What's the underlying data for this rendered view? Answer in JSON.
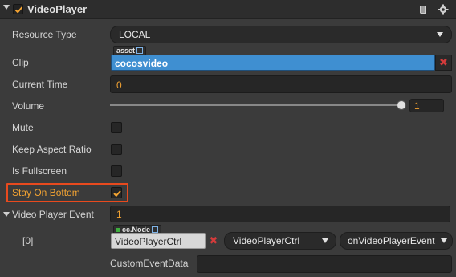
{
  "header": {
    "title": "VideoPlayer",
    "enabled": true,
    "icons": [
      "book-icon",
      "gear-icon"
    ]
  },
  "properties": {
    "resource_type": {
      "label": "Resource Type",
      "value": "LOCAL"
    },
    "clip": {
      "label": "Clip",
      "tag": "asset",
      "value": "cocosvideo"
    },
    "current_time": {
      "label": "Current Time",
      "value": "0"
    },
    "volume": {
      "label": "Volume",
      "value": "1",
      "level": 1.0
    },
    "mute": {
      "label": "Mute",
      "checked": false
    },
    "keep_aspect_ratio": {
      "label": "Keep Aspect Ratio",
      "checked": false
    },
    "is_fullscreen": {
      "label": "Is Fullscreen",
      "checked": false
    },
    "stay_on_bottom": {
      "label": "Stay On Bottom",
      "checked": true
    },
    "video_player_event": {
      "label": "Video Player Event",
      "count": "1"
    }
  },
  "event_item": {
    "index_label": "[0]",
    "tag": "cc.Node",
    "target": "VideoPlayerCtrl",
    "component": "VideoPlayerCtrl",
    "handler": "onVideoPlayerEvent",
    "custom_label": "CustomEventData",
    "custom_value": ""
  },
  "colors": {
    "accent_orange": "#f3a332",
    "asset_blue": "#3f8fd1",
    "highlight_red": "#e84a1e"
  }
}
